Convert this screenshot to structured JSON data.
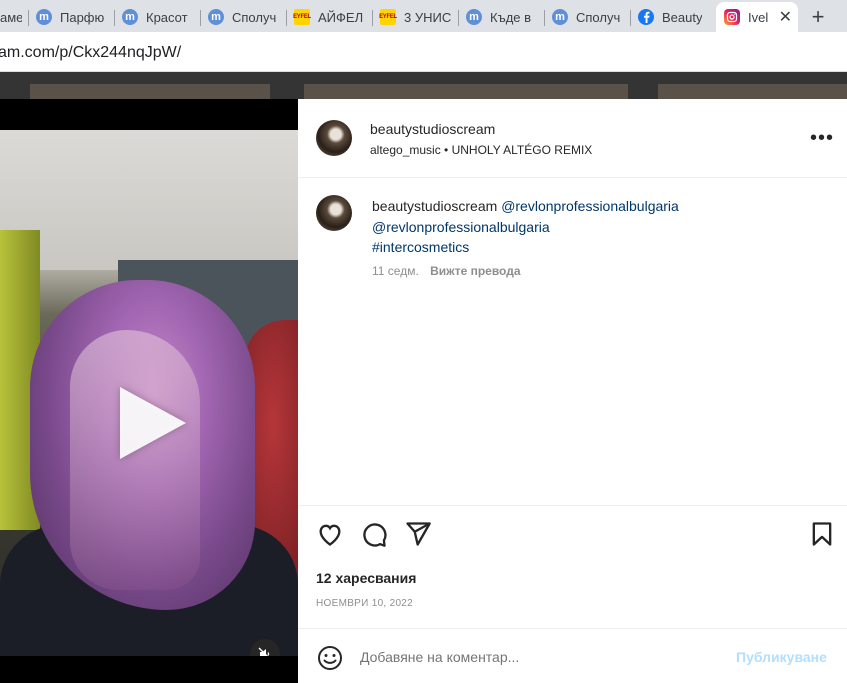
{
  "browser": {
    "tabs": [
      {
        "title": "аме",
        "favicon": "none"
      },
      {
        "title": "Парфю",
        "favicon": "m-icon"
      },
      {
        "title": "Красот",
        "favicon": "m-icon"
      },
      {
        "title": "Сполуч",
        "favicon": "m-icon"
      },
      {
        "title": "АЙФЕЛ",
        "favicon": "eyfel-icon",
        "favicon_text": "EYFEL"
      },
      {
        "title": "3 УНИС",
        "favicon": "eyfel-icon",
        "favicon_text": "EYFEL"
      },
      {
        "title": "Къде в",
        "favicon": "m-icon"
      },
      {
        "title": "Сполуч",
        "favicon": "m-icon"
      },
      {
        "title": "Beauty",
        "favicon": "facebook-icon"
      },
      {
        "title": "Ivel",
        "favicon": "instagram-icon",
        "active": true
      }
    ],
    "new_tab": "+",
    "url": "am.com/p/Ckx244nqJpW/"
  },
  "post": {
    "header": {
      "username": "beautystudioscream",
      "audio": "altego_music • UNHOLY ALTÉGO REMIX",
      "more": "•••"
    },
    "caption": {
      "username": "beautystudioscream",
      "mention1": "@revlonprofessionalbulgaria",
      "mention2": "@revlonprofessionalbulgaria",
      "hashtag": "#intercosmetics",
      "age": "11 седм.",
      "translate": "Вижте превода"
    },
    "likes": "12 харесвания",
    "date": "НОЕМВРИ 10, 2022",
    "comment": {
      "placeholder": "Добавяне на коментар...",
      "post_label": "Публикуване"
    }
  },
  "colors": {
    "link": "#00376b",
    "muted": "#8e8e8e",
    "post_disabled": "#b2dffc",
    "backdrop": "#343434"
  }
}
